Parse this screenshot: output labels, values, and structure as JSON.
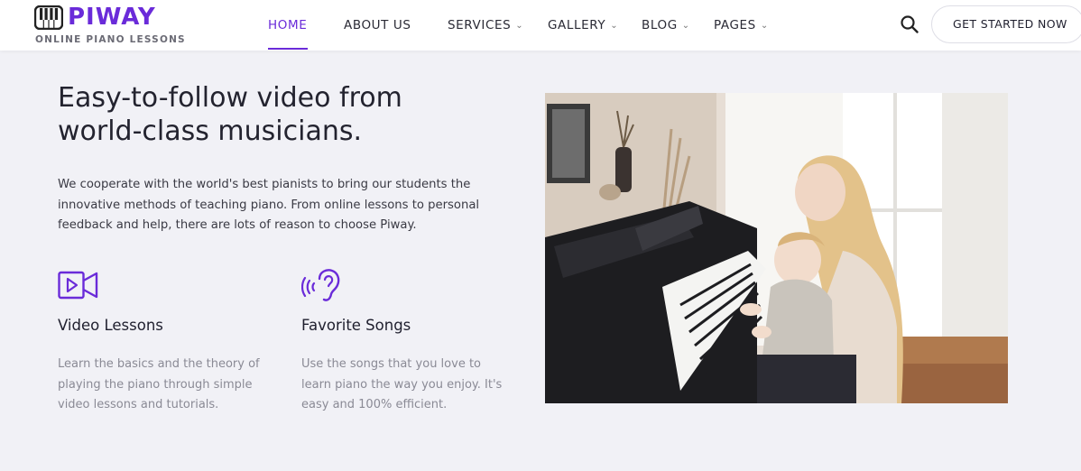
{
  "brand": {
    "name": "PIWAY",
    "tagline": "ONLINE PIANO LESSONS",
    "accent": "#6a2bd9"
  },
  "nav": {
    "items": [
      {
        "label": "HOME",
        "active": true,
        "dropdown": false
      },
      {
        "label": "ABOUT US",
        "active": false,
        "dropdown": false
      },
      {
        "label": "SERVICES",
        "active": false,
        "dropdown": true
      },
      {
        "label": "GALLERY",
        "active": false,
        "dropdown": true
      },
      {
        "label": "BLOG",
        "active": false,
        "dropdown": true
      },
      {
        "label": "PAGES",
        "active": false,
        "dropdown": true
      }
    ],
    "search_icon": "search-icon",
    "cta_label": "GET STARTED NOW"
  },
  "hero": {
    "headline_line1": "Easy-to-follow video from",
    "headline_line2": "world-class musicians.",
    "intro": "We cooperate with the world's best pianists to bring our students the innovative methods of teaching piano. From online lessons to personal feedback and help, there are lots of reason to choose Piway."
  },
  "features": [
    {
      "icon": "video-camera-icon",
      "title": "Video Lessons",
      "text": "Learn the basics and the theory of playing the piano through simple video lessons and tutorials."
    },
    {
      "icon": "ear-hearing-icon",
      "title": "Favorite Songs",
      "text": "Use the songs that you love to learn piano the way you enjoy. It's easy and 100% efficient."
    }
  ]
}
